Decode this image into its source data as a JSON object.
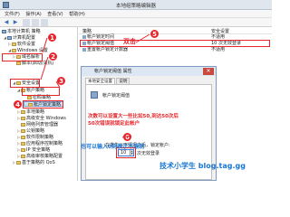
{
  "window": {
    "title": "本地组策略编辑器"
  },
  "menu": [
    "文件(F)",
    "操作(A)",
    "查看(V)",
    "帮助(H)"
  ],
  "toolbar": {
    "back": "◀",
    "forward": "▶"
  },
  "tree": {
    "items": [
      {
        "label": "本地计算机 策略",
        "icon": "computer-icon"
      },
      {
        "label": "计算机配置",
        "icon": "computer-icon"
      },
      {
        "label": "软件设置",
        "icon": "folder-icon"
      },
      {
        "label": "Windows 设置",
        "icon": "folder-icon"
      },
      {
        "label": "域名解析",
        "icon": "folder-icon"
      },
      {
        "label": "脚本(启动/关机)",
        "icon": "folder-icon"
      },
      {
        "label": "安全设置",
        "icon": "folder-icon"
      },
      {
        "label": "帐户策略",
        "icon": "folder-icon"
      },
      {
        "label": "密码策略",
        "icon": "folder-icon"
      },
      {
        "label": "帐户锁定策略",
        "icon": "folder-icon"
      },
      {
        "label": "本地策略",
        "icon": "folder-icon"
      },
      {
        "label": "高级安全 Windows",
        "icon": "folder-icon"
      },
      {
        "label": "网络列表管理器",
        "icon": "folder-icon"
      },
      {
        "label": "公钥策略",
        "icon": "folder-icon"
      },
      {
        "label": "软件限制策略",
        "icon": "folder-icon"
      },
      {
        "label": "应用程序控制策略",
        "icon": "folder-icon"
      },
      {
        "label": "IP 安全策略",
        "icon": "folder-icon"
      },
      {
        "label": "高级审核策略配置",
        "icon": "folder-icon"
      },
      {
        "label": "基于策略的 QoS",
        "icon": "folder-icon"
      }
    ]
  },
  "list": {
    "headers": [
      "策略",
      "安全设置"
    ],
    "rows": [
      {
        "name": "帐户锁定时间",
        "value": "不适用"
      },
      {
        "name": "帐户锁定阈值",
        "value": "10 次无效登录"
      },
      {
        "name": "重置帐户锁定计数器",
        "value": "不适用"
      }
    ]
  },
  "dialog": {
    "title": "帐户锁定阈值 属性",
    "tabs": [
      "本地安全设置",
      "说明"
    ],
    "policy_name": "帐户锁定阈值",
    "field_label": "在发生以下情况之后，锁定帐户:",
    "value": "10",
    "unit": "次无效登录"
  },
  "annotations": {
    "markers": [
      "1",
      "2",
      "3",
      "4",
      "5",
      "6"
    ],
    "double_click": "双击",
    "note_line1": "次数可以设置大一些比如50,到达50次后",
    "note_line2": "50次错误就锁定此帐户",
    "note_zero": "也可以输入0则表示不限制",
    "brand": "技术小学生 blog.tag.gg",
    "colors": {
      "red": "#e6252b",
      "blue": "#1976d2",
      "badge": "#e8232a"
    }
  }
}
